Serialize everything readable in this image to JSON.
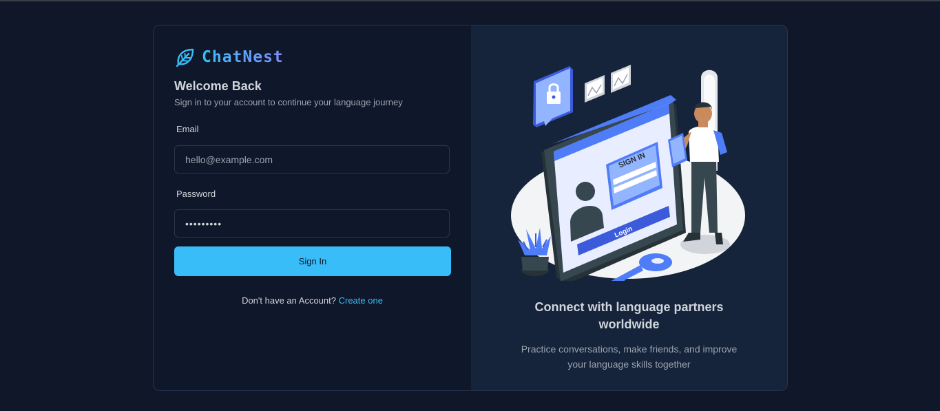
{
  "brand": {
    "name": "ChatNest",
    "icon": "leaf-icon"
  },
  "login": {
    "title": "Welcome Back",
    "subtitle": "Sign in to your account to continue your language journey",
    "email_label": "Email",
    "email_placeholder": "hello@example.com",
    "password_label": "Password",
    "password_value": "•••••••••",
    "signin_label": "Sign In",
    "footer_text": "Don't have an Account?",
    "footer_link": "Create one"
  },
  "illustration": {
    "sign_in_heading": "SIGN IN",
    "login_button": "Login"
  },
  "promo": {
    "title": "Connect with language partners worldwide",
    "subtitle": "Practice conversations, make friends, and improve your language skills together"
  },
  "colors": {
    "accent": "#38bdf8",
    "background": "#0f172a",
    "panel": "#15233b",
    "illustration_blue": "#4f7cf7"
  }
}
